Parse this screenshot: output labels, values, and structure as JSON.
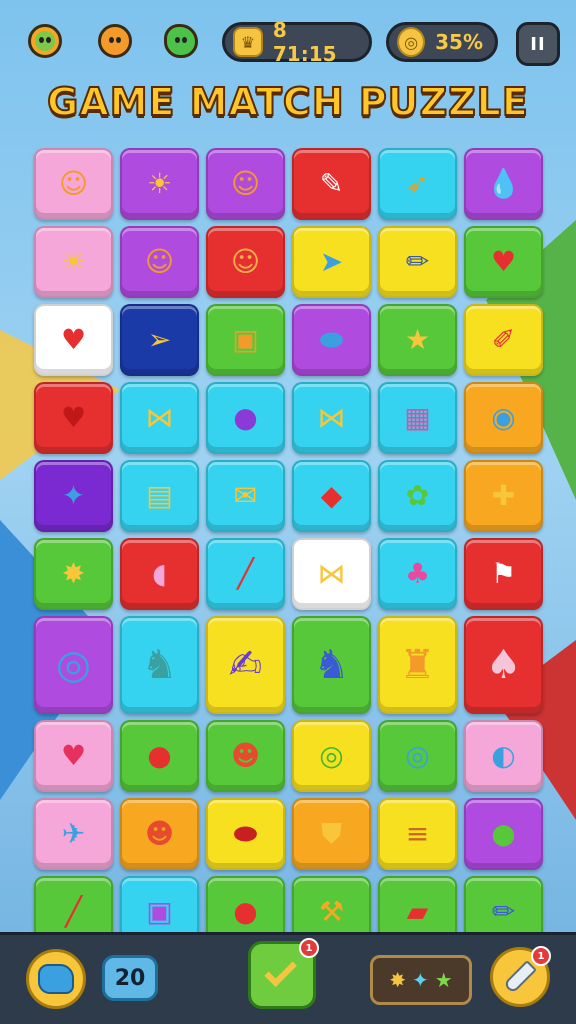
{
  "header": {
    "coins_value": "8 71:15",
    "progress_value": "35%",
    "pause_label": "II",
    "coin_icon": "crown-coin-icon",
    "progress_icon": "spiral-coin-icon",
    "mascots": [
      "green-sun-mascot-icon",
      "orange-sun-mascot-icon",
      "green-apple-mascot-icon"
    ]
  },
  "title": "GAME MATCH PUZZLE",
  "board": {
    "rows": [
      {
        "size": "normal",
        "tiles": [
          {
            "bg": "#f4a7d8",
            "icon": "sun-face-icon",
            "glyph": "☺",
            "color": "#f39a2b"
          },
          {
            "bg": "#b04be0",
            "icon": "sun-face-icon",
            "glyph": "☀",
            "color": "#f7c63a"
          },
          {
            "bg": "#b04be0",
            "icon": "sun-face-icon",
            "glyph": "☺",
            "color": "#f39a2b"
          },
          {
            "bg": "#e63030",
            "icon": "pencil-icon",
            "glyph": "✎",
            "color": "#ffffff"
          },
          {
            "bg": "#35d3ef",
            "icon": "arrow-icon",
            "glyph": "➶",
            "color": "#e8a020"
          },
          {
            "bg": "#b04be0",
            "icon": "drop-icon",
            "glyph": "💧",
            "color": "#e63030"
          }
        ]
      },
      {
        "size": "normal",
        "tiles": [
          {
            "bg": "#f4a7d8",
            "icon": "sun-face-icon",
            "glyph": "☀",
            "color": "#f7c63a"
          },
          {
            "bg": "#b04be0",
            "icon": "sun-face-icon",
            "glyph": "☺",
            "color": "#f39a2b"
          },
          {
            "bg": "#e63030",
            "icon": "sun-face-icon",
            "glyph": "☺",
            "color": "#f7b04a"
          },
          {
            "bg": "#f7e020",
            "icon": "paper-plane-icon",
            "glyph": "➤",
            "color": "#3aa0e0"
          },
          {
            "bg": "#f7e020",
            "icon": "pencil-icon",
            "glyph": "✏",
            "color": "#3a5aa0"
          },
          {
            "bg": "#56c83a",
            "icon": "heart-icon",
            "glyph": "♥",
            "color": "#e63030"
          }
        ]
      },
      {
        "size": "normal",
        "tiles": [
          {
            "bg": "#ffffff",
            "icon": "heart-icon",
            "glyph": "♥",
            "color": "#e63030"
          },
          {
            "bg": "#1a3aa8",
            "icon": "banner-icon",
            "glyph": "➢",
            "color": "#f7c63a"
          },
          {
            "bg": "#56c83a",
            "icon": "bag-icon",
            "glyph": "▣",
            "color": "#f39a2b"
          },
          {
            "bg": "#b04be0",
            "icon": "candy-icon",
            "glyph": "⬬",
            "color": "#3aa0e0"
          },
          {
            "bg": "#56c83a",
            "icon": "star-icon",
            "glyph": "★",
            "color": "#f7c63a"
          },
          {
            "bg": "#f7e020",
            "icon": "pencil-icon",
            "glyph": "✐",
            "color": "#e63030"
          }
        ]
      },
      {
        "size": "normal",
        "tiles": [
          {
            "bg": "#e63030",
            "icon": "heart-icon",
            "glyph": "♥",
            "color": "#c01818"
          },
          {
            "bg": "#35d3ef",
            "icon": "fish-icon",
            "glyph": "⋈",
            "color": "#f7c63a"
          },
          {
            "bg": "#35d3ef",
            "icon": "blob-icon",
            "glyph": "●",
            "color": "#8a3ad6"
          },
          {
            "bg": "#35d3ef",
            "icon": "bow-icon",
            "glyph": "⋈",
            "color": "#f7c63a"
          },
          {
            "bg": "#35d3ef",
            "icon": "robot-icon",
            "glyph": "▦",
            "color": "#e84aa0"
          },
          {
            "bg": "#f7a820",
            "icon": "camera-icon",
            "glyph": "◉",
            "color": "#3aa0e0"
          }
        ]
      },
      {
        "size": "normal",
        "tiles": [
          {
            "bg": "#7a2ad0",
            "icon": "gem-icon",
            "glyph": "✦",
            "color": "#3aa0e0"
          },
          {
            "bg": "#35d3ef",
            "icon": "book-icon",
            "glyph": "▤",
            "color": "#f7c63a"
          },
          {
            "bg": "#35d3ef",
            "icon": "envelope-icon",
            "glyph": "✉",
            "color": "#f7c63a"
          },
          {
            "bg": "#35d3ef",
            "icon": "cube-icon",
            "glyph": "◆",
            "color": "#e63030"
          },
          {
            "bg": "#35d3ef",
            "icon": "frog-icon",
            "glyph": "✿",
            "color": "#56c83a"
          },
          {
            "bg": "#f7a820",
            "icon": "ticket-icon",
            "glyph": "✚",
            "color": "#f7c63a"
          }
        ]
      },
      {
        "size": "normal",
        "tiles": [
          {
            "bg": "#56c83a",
            "icon": "star-icon",
            "glyph": "✸",
            "color": "#f7c63a"
          },
          {
            "bg": "#e63030",
            "icon": "fish-icon",
            "glyph": "◖",
            "color": "#f4a7d8"
          },
          {
            "bg": "#35d3ef",
            "icon": "crayon-icon",
            "glyph": "╱",
            "color": "#e63030"
          },
          {
            "bg": "#ffffff",
            "icon": "fish-icon",
            "glyph": "⋈",
            "color": "#f7c63a"
          },
          {
            "bg": "#35d3ef",
            "icon": "lollipop-icon",
            "glyph": "♣",
            "color": "#e84aa0"
          },
          {
            "bg": "#e63030",
            "icon": "flag-icon",
            "glyph": "⚑",
            "color": "#ffffff"
          }
        ]
      },
      {
        "size": "tall",
        "tiles": [
          {
            "bg": "#b04be0",
            "icon": "ring-icon",
            "glyph": "◎",
            "color": "#3aa0e0"
          },
          {
            "bg": "#35d3ef",
            "icon": "seahorse-icon",
            "glyph": "♞",
            "color": "#3aa0a0"
          },
          {
            "bg": "#f7e020",
            "icon": "open-book-icon",
            "glyph": "✍",
            "color": "#6a3ad6"
          },
          {
            "bg": "#56c83a",
            "icon": "bird-icon",
            "glyph": "♞",
            "color": "#3a5ad6"
          },
          {
            "bg": "#f7e020",
            "icon": "octopus-icon",
            "glyph": "♜",
            "color": "#f39a2b"
          },
          {
            "bg": "#e63030",
            "icon": "cotton-candy-icon",
            "glyph": "♠",
            "color": "#f4c4d8"
          }
        ]
      },
      {
        "size": "normal",
        "tiles": [
          {
            "bg": "#f4a7d8",
            "icon": "heart-icon",
            "glyph": "♥",
            "color": "#e63060"
          },
          {
            "bg": "#56c83a",
            "icon": "apple-icon",
            "glyph": "●",
            "color": "#e63030"
          },
          {
            "bg": "#56c83a",
            "icon": "chat-face-icon",
            "glyph": "☻",
            "color": "#e84a30"
          },
          {
            "bg": "#f7e020",
            "icon": "swirl-icon",
            "glyph": "◎",
            "color": "#3ab830"
          },
          {
            "bg": "#56c83a",
            "icon": "magnifier-icon",
            "glyph": "◎",
            "color": "#3aa0e0"
          },
          {
            "bg": "#f4a7d8",
            "icon": "speech-bubble-icon",
            "glyph": "◐",
            "color": "#3aa0e0"
          }
        ]
      },
      {
        "size": "normal",
        "tiles": [
          {
            "bg": "#f4a7d8",
            "icon": "bag-icon",
            "glyph": "✈",
            "color": "#3aa0e0"
          },
          {
            "bg": "#f7a820",
            "icon": "chat-face-icon",
            "glyph": "☻",
            "color": "#e84a30"
          },
          {
            "bg": "#f7e020",
            "icon": "bean-icon",
            "glyph": "⬬",
            "color": "#c82020"
          },
          {
            "bg": "#f7a820",
            "icon": "shield-icon",
            "glyph": "⛊",
            "color": "#f7c63a"
          },
          {
            "bg": "#f7e020",
            "icon": "burger-icon",
            "glyph": "≡",
            "color": "#c86a20"
          },
          {
            "bg": "#b04be0",
            "icon": "potion-icon",
            "glyph": "●",
            "color": "#56c83a"
          }
        ]
      },
      {
        "size": "normal",
        "tiles": [
          {
            "bg": "#56c83a",
            "icon": "crayon-icon",
            "glyph": "╱",
            "color": "#e63030"
          },
          {
            "bg": "#35d3ef",
            "icon": "bag-icon",
            "glyph": "▣",
            "color": "#b04be0"
          },
          {
            "bg": "#56c83a",
            "icon": "bean-icon",
            "glyph": "●",
            "color": "#e63030"
          },
          {
            "bg": "#56c83a",
            "icon": "hammer-icon",
            "glyph": "⚒",
            "color": "#f7a820"
          },
          {
            "bg": "#56c83a",
            "icon": "card-icon",
            "glyph": "▰",
            "color": "#e63030"
          },
          {
            "bg": "#56c83a",
            "icon": "pencil-icon",
            "glyph": "✏",
            "color": "#3a5ad6"
          }
        ]
      }
    ]
  },
  "footer": {
    "puzzle_icon": "puzzle-piece-icon",
    "moves_value": "20",
    "check_icon": "checkmark-icon",
    "check_badge": "1",
    "stars_icon": "stars-icon",
    "hint_icon": "pen-hint-icon",
    "hint_badge": "1"
  }
}
